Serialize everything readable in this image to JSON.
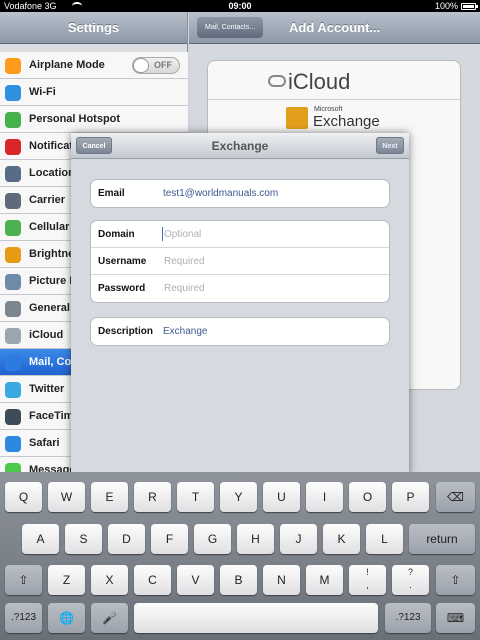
{
  "status_bar": {
    "carrier": "Vodafone 3G",
    "time": "09:00",
    "battery": "100%"
  },
  "left_nav": {
    "title": "Settings"
  },
  "settings_items": [
    {
      "label": "Airplane Mode",
      "icon": "airplane-icon",
      "color": "#ff9b1a",
      "toggle": "OFF"
    },
    {
      "label": "Wi-Fi",
      "icon": "wifi-icon",
      "color": "#2f8fe0"
    },
    {
      "label": "Personal Hotspot",
      "icon": "hotspot-icon",
      "color": "#45b14b"
    },
    {
      "label": "Notifications",
      "icon": "notifications-icon",
      "color": "#d9262b"
    },
    {
      "label": "Location Services",
      "icon": "location-icon",
      "color": "#5a6b85"
    },
    {
      "label": "Carrier",
      "icon": "phone-icon",
      "color": "#5f6a7a"
    },
    {
      "label": "Cellular Data",
      "icon": "cellular-icon",
      "color": "#4caf50"
    },
    {
      "label": "Brightness & Wallpaper",
      "icon": "brightness-icon",
      "color": "#e79b15"
    },
    {
      "label": "Picture Frame",
      "icon": "picture-frame-icon",
      "color": "#6f8aa8"
    },
    {
      "label": "General",
      "icon": "gear-icon",
      "color": "#7d8590"
    },
    {
      "label": "iCloud",
      "icon": "icloud-icon",
      "color": "#9aa5b2"
    },
    {
      "label": "Mail, Contacts, Calendars",
      "icon": "mail-icon",
      "color": "#2c7be0"
    },
    {
      "label": "Twitter",
      "icon": "twitter-icon",
      "color": "#39a9e0"
    },
    {
      "label": "FaceTime",
      "icon": "facetime-icon",
      "color": "#3e4b59"
    },
    {
      "label": "Safari",
      "icon": "safari-icon",
      "color": "#2d88de"
    },
    {
      "label": "Messages",
      "icon": "messages-icon",
      "color": "#4cc84b"
    }
  ],
  "right_nav": {
    "back_label": "Mail, Contacts...",
    "title": "Add Account..."
  },
  "accounts": {
    "icloud": "iCloud",
    "microsoft": "Microsoft",
    "exchange": "Exchange"
  },
  "modal": {
    "title": "Exchange",
    "cancel_label": "Cancel",
    "next_label": "Next",
    "email_label": "Email",
    "email_value": "test1@worldmanuals.com",
    "domain_label": "Domain",
    "domain_placeholder": "Optional",
    "username_label": "Username",
    "username_placeholder": "Required",
    "password_label": "Password",
    "password_placeholder": "Required",
    "description_label": "Description",
    "description_value": "Exchange"
  },
  "keyboard": {
    "row1": [
      "Q",
      "W",
      "E",
      "R",
      "T",
      "Y",
      "U",
      "I",
      "O",
      "P"
    ],
    "row2": [
      "A",
      "S",
      "D",
      "F",
      "G",
      "H",
      "J",
      "K",
      "L"
    ],
    "row3": [
      "Z",
      "X",
      "C",
      "V",
      "B",
      "N",
      "M"
    ],
    "return_label": "return",
    "num_label": ".?123",
    "punct1": [
      "!",
      ","
    ],
    "punct2": [
      "?",
      "."
    ]
  }
}
